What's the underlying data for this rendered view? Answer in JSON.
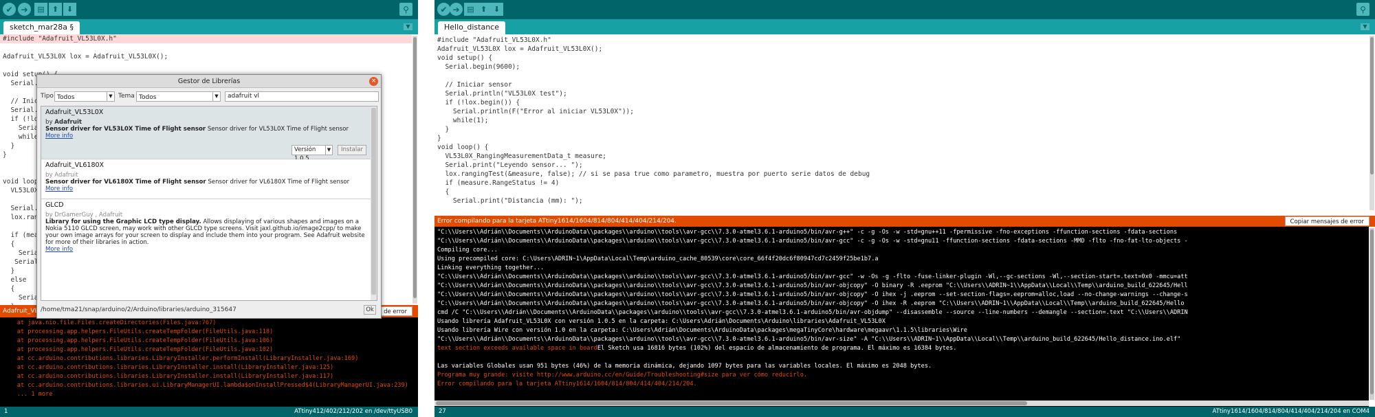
{
  "colors": {
    "toolbar": "#006468",
    "tabbar": "#17a1a5",
    "error_bar": "#e34c00",
    "console_bg": "#000000",
    "error_text": "#e34c00"
  },
  "left": {
    "toolbar_icons": [
      "verify-icon",
      "upload-icon",
      "new-icon",
      "open-icon",
      "save-icon",
      "serial-monitor-icon"
    ],
    "tab_label": "sketch_mar28a §",
    "code_lines": [
      "#include \"Adafruit_VL53L0X.h\"",
      "",
      "Adafruit_VL53L0X lox = Adafruit_VL53L0X();",
      "",
      "void setup() {",
      "  Serial.be",
      "",
      "  // Inicia",
      "  Serial.pr",
      "  if (!lox.",
      "    Serial.",
      "    while(1",
      "  }",
      "}",
      "",
      "",
      "void loop()",
      "  VL53L0X_R",
      "",
      "  Serial.pr",
      "  lox.rangi",
      "",
      "  if (measu",
      "  {",
      "    Serial.",
      "   Serial.p",
      "  }",
      "  else",
      "  {",
      "    Serial.",
      "  }",
      "",
      "  delay(100"
    ],
    "message_bar": "Adafruit_VL53",
    "copy_button": "sajes de error",
    "console_lines": [
      "    at java.nio.file.Files.createDirectories(Files.java:767)",
      "    at processing.app.helpers.FileUtils.createTempFolder(FileUtils.java:118)",
      "    at processing.app.helpers.FileUtils.createTempFolder(FileUtils.java:106)",
      "    at processing.app.helpers.FileUtils.createTempFolder(FileUtils.java:102)",
      "    at cc.arduino.contributions.libraries.LibraryInstaller.performInstall(LibraryInstaller.java:169)",
      "    at cc.arduino.contributions.libraries.LibraryInstaller.install(LibraryInstaller.java:125)",
      "    at cc.arduino.contributions.libraries.LibraryInstaller.install(LibraryInstaller.java:117)",
      "    at cc.arduino.contributions.libraries.ui.LibraryManagerUI.lambda$onInstallPressed$4(LibraryManagerUI.java:239)",
      "    ... 1 more"
    ],
    "status_left": "1",
    "status_right": "ATtiny412/402/212/202 en /dev/ttyUSB0"
  },
  "dialog": {
    "title": "Gestor de Librerías",
    "tipo_label": "Tipo",
    "tipo_value": "Todos",
    "tema_label": "Tema",
    "tema_value": "Todos",
    "search_value": "adafruit vl",
    "libraries": [
      {
        "name": "Adafruit_VL53L0X",
        "by_prefix": "by ",
        "author": "Adafruit",
        "desc_bold": "Sensor driver for VL53L0X Time of Flight sensor",
        "desc": " Sensor driver for VL53L0X Time of Flight sensor",
        "more": "More info",
        "version": "Versión 1.0.5",
        "install": "Instalar"
      },
      {
        "name": "Adafruit_VL6180X",
        "by_prefix": "by ",
        "author": "Adafruit",
        "desc_bold": "Sensor driver for VL6180X Time of Flight sensor",
        "desc": " Sensor driver for VL6180X Time of Flight sensor",
        "more": "More info"
      },
      {
        "name": "GLCD",
        "by_prefix": "by ",
        "author": "DrGamerGuy , Adafruit",
        "desc_bold": "Library for using the Graphic LCD type display.",
        "desc": " Allows displaying of various shapes and images on a Nokia 5110 GLCD screen, may work with other GLCD type screens. Visit jaxl.github.io/image2cpp/ to make your own image arrays for your screen to display and include them into your program. See Adafruit website for more of their libraries in action.",
        "more": "More info"
      }
    ],
    "footer_path": "/home/tma21/snap/arduino/2/Arduino/libraries/arduino_315647",
    "ok": "Ok"
  },
  "right": {
    "toolbar_icons": [
      "verify-icon",
      "upload-icon",
      "new-icon",
      "open-icon",
      "save-icon",
      "serial-monitor-icon"
    ],
    "tab_label": "Hello_distance",
    "code_lines": [
      "#include \"Adafruit_VL53L0X.h\"",
      "Adafruit_VL53L0X lox = Adafruit_VL53L0X();",
      "void setup() {",
      "  Serial.begin(9600);",
      "",
      "  // Iniciar sensor",
      "  Serial.println(\"VL53L0X test\");",
      "  if (!lox.begin()) {",
      "    Serial.println(F(\"Error al iniciar VL53L0X\"));",
      "    while(1);",
      "  }",
      "}",
      "void loop() {",
      "  VL53L0X_RangingMeasurementData_t measure;",
      "  Serial.print(\"Leyendo sensor... \");",
      "  lox.rangingTest(&measure, false); // si se pasa true como parametro, muestra por puerto serie datos de debug",
      "  if (measure.RangeStatus != 4)",
      "  {",
      "    Serial.print(\"Distancia (mm): \");"
    ],
    "message_bar": "Error compilando para la tarjeta ATtiny1614/1604/814/804/414/404/214/204.",
    "copy_button": "Copiar mensajes de error",
    "console_lines": [
      {
        "t": "\"C:\\\\Users\\\\Adrián\\\\Documents\\\\ArduinoData\\\\packages\\\\arduino\\\\tools\\\\avr-gcc\\\\7.3.0-atmel3.6.1-arduino5/bin/avr-g++\" -c -g -Os -w -std=gnu++11 -fpermissive -fno-exceptions -ffunction-sections -fdata-sections",
        "e": false
      },
      {
        "t": "\"C:\\\\Users\\\\Adrián\\\\Documents\\\\ArduinoData\\\\packages\\\\arduino\\\\tools\\\\avr-gcc\\\\7.3.0-atmel3.6.1-arduino5/bin/avr-gcc\" -c -g -Os -w -std=gnu11 -ffunction-sections -fdata-sections -MMD -flto -fno-fat-lto-objects -",
        "e": false
      },
      {
        "t": "Compiling core...",
        "e": false
      },
      {
        "t": "Using precompiled core: C:\\Users\\ADRIN~1\\AppData\\Local\\Temp\\arduino_cache_80539\\core\\core_66f4f20dc6f80947cd7c2459f25be1b7.a",
        "e": false
      },
      {
        "t": "Linking everything together...",
        "e": false
      },
      {
        "t": "\"C:\\\\Users\\\\Adrián\\\\Documents\\\\ArduinoData\\\\packages\\\\arduino\\\\tools\\\\avr-gcc\\\\7.3.0-atmel3.6.1-arduino5/bin/avr-gcc\" -w -Os -g -flto -fuse-linker-plugin -Wl,--gc-sections -Wl,--section-start=.text=0x0 -mmcu=att",
        "e": false
      },
      {
        "t": "\"C:\\\\Users\\\\Adrián\\\\Documents\\\\ArduinoData\\\\packages\\\\arduino\\\\tools\\\\avr-gcc\\\\7.3.0-atmel3.6.1-arduino5/bin/avr-objcopy\" -O binary -R .eeprom \"C:\\\\Users\\\\ADRIN~1\\\\AppData\\\\Local\\\\Temp\\\\arduino_build_622645/Hell",
        "e": false
      },
      {
        "t": "\"C:\\\\Users\\\\Adrián\\\\Documents\\\\ArduinoData\\\\packages\\\\arduino\\\\tools\\\\avr-gcc\\\\7.3.0-atmel3.6.1-arduino5/bin/avr-objcopy\" -O ihex -j .eeprom --set-section-flags=.eeprom=alloc,load --no-change-warnings --change-s",
        "e": false
      },
      {
        "t": "\"C:\\\\Users\\\\Adrián\\\\Documents\\\\ArduinoData\\\\packages\\\\arduino\\\\tools\\\\avr-gcc\\\\7.3.0-atmel3.6.1-arduino5/bin/avr-objcopy\" -O ihex -R .eeprom \"C:\\\\Users\\\\ADRIN~1\\\\AppData\\\\Local\\\\Temp\\\\arduino_build_622645/Hello",
        "e": false
      },
      {
        "t": "cmd /C \"C:\\\\Users\\\\Adrián\\\\Documents\\\\ArduinoData\\\\packages\\\\arduino\\\\tools\\\\avr-gcc\\\\7.3.0-atmel3.6.1-arduino5/bin/avr-objdump\" --disassemble --source --line-numbers --demangle --section=.text \"C:\\\\Users\\\\ADRIN",
        "e": false
      },
      {
        "t": "Usando librería Adafruit_VL53L0X con versión 1.0.5 en la carpeta: C:\\Users\\Adrián\\Documents\\Arduino\\libraries\\Adafruit_VL53L0X",
        "e": false
      },
      {
        "t": "Usando librería Wire con versión 1.0 en la carpeta: C:\\Users\\Adrián\\Documents\\ArduinoData\\packages\\megaTinyCore\\hardware\\megaavr\\1.1.5\\libraries\\Wire",
        "e": false
      },
      {
        "t": "\"C:\\\\Users\\\\Adrián\\\\Documents\\\\ArduinoData\\\\packages\\\\arduino\\\\tools\\\\avr-gcc\\\\7.3.0-atmel3.6.1-arduino5/bin/avr-size\" -A \"C:\\\\Users\\\\ADRIN~1\\\\AppData\\\\Local\\\\Temp\\\\arduino_build_622645/Hello_distance.ino.elf\"",
        "e": false
      },
      {
        "t": "text section exceeds available space in board",
        "e": true,
        "tail": "El Sketch usa 16816 bytes (102%) del espacio de almacenamiento de programa. El máximo es 16384 bytes."
      },
      {
        "t": "",
        "e": false
      },
      {
        "t": "Las variables Globales usan 951 bytes (46%) de la memoria dinámica, dejando 1097 bytes para las variables locales. El máximo es 2048 bytes.",
        "e": false
      },
      {
        "t": "Programa muy grande: visite http://www.arduino.cc/en/Guide/Troubleshooting#size para ver cómo reducirlo.",
        "e": true
      },
      {
        "t": "Error compilando para la tarjeta ATtiny1614/1604/814/804/414/404/214/204.",
        "e": true
      }
    ],
    "status_left": "27",
    "status_right": "ATtiny1614/1604/814/804/414/404/214/204 en COM4"
  }
}
